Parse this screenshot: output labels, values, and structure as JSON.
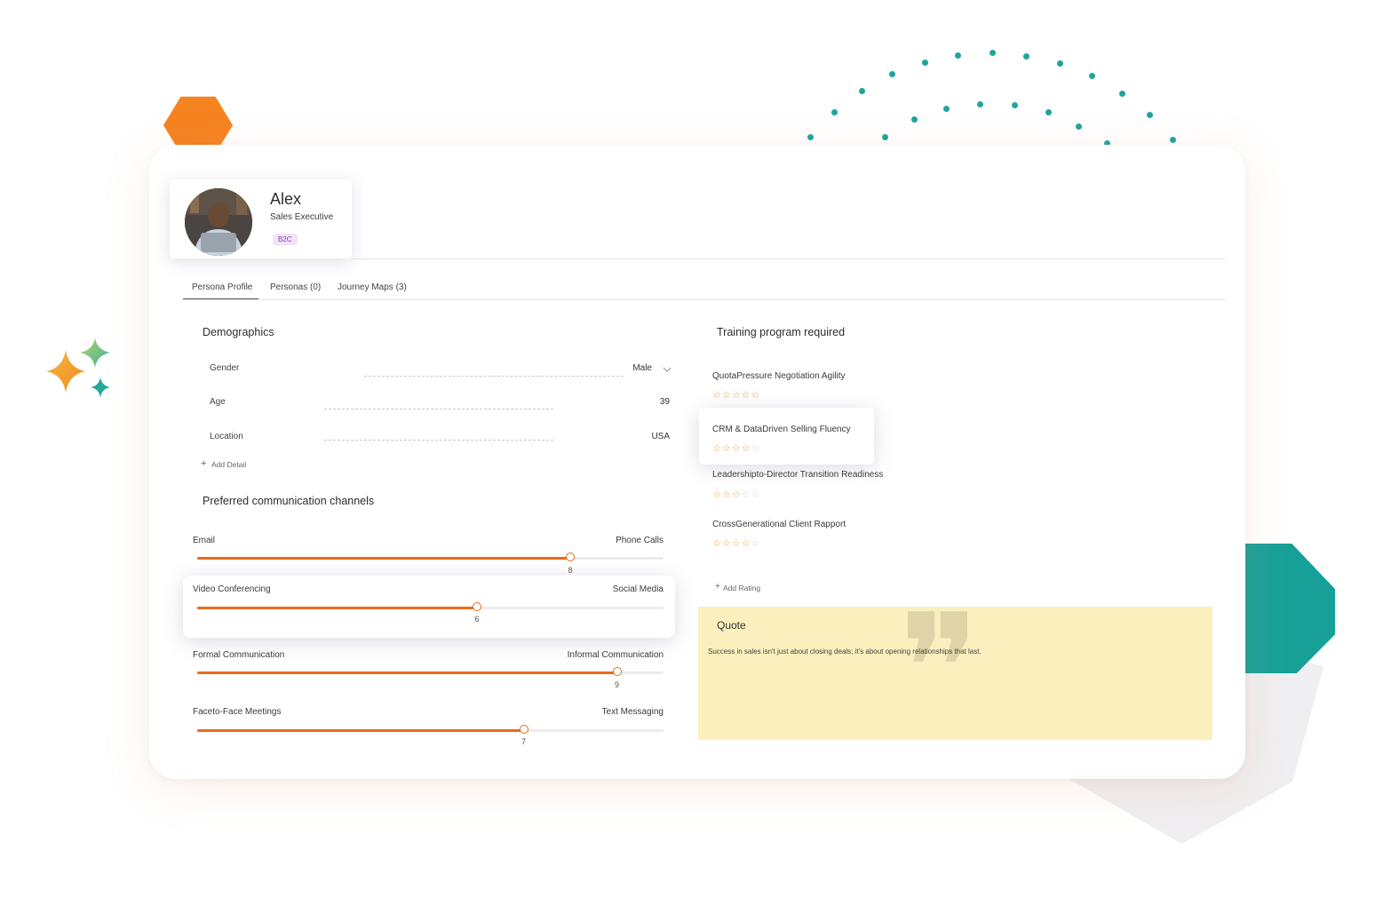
{
  "profile": {
    "name": "Alex",
    "role": "Sales Executive",
    "badge": "B2C",
    "avatar_icon": "person-photo-icon"
  },
  "tabs": [
    {
      "label": "Persona Profile",
      "active": true
    },
    {
      "label": "Personas (0)",
      "active": false
    },
    {
      "label": "Journey Maps (3)",
      "active": false
    }
  ],
  "demographics": {
    "title": "Demographics",
    "rows": [
      {
        "label": "Gender",
        "value": "Male"
      },
      {
        "label": "Age",
        "value": "39"
      },
      {
        "label": "Location",
        "value": "USA"
      }
    ],
    "add_label": "Add Detail"
  },
  "channels": {
    "title": "Preferred communication channels",
    "sliders": [
      {
        "left": "Email",
        "right": "Phone Calls",
        "value": 8,
        "max": 10
      },
      {
        "left": "Video Conferencing",
        "right": "Social Media",
        "value": 6,
        "max": 10
      },
      {
        "left": "Formal Communication",
        "right": "Informal Communication",
        "value": 9,
        "max": 10
      },
      {
        "left": "Faceto-Face Meetings",
        "right": "Text Messaging",
        "value": 7,
        "max": 10
      }
    ]
  },
  "training": {
    "title": "Training program required",
    "items": [
      {
        "name": "QuotaPressure Negotiation Agility",
        "rating": 5
      },
      {
        "name": "CRM & DataDriven Selling Fluency",
        "rating": 4
      },
      {
        "name": "Leadershipto-Director Transition Readiness",
        "rating": 3
      },
      {
        "name": "CrossGenerational Client Rapport",
        "rating": 4
      }
    ],
    "add_label": "Add Rating"
  },
  "quote": {
    "title": "Quote",
    "text": "Success in sales isn't just about closing deals; it's about opening relationships that last."
  },
  "colors": {
    "accent_orange": "#ea6a1c",
    "teal": "#1fa59c",
    "quote_bg": "#fbf0bd",
    "star": "#e8a33d"
  }
}
